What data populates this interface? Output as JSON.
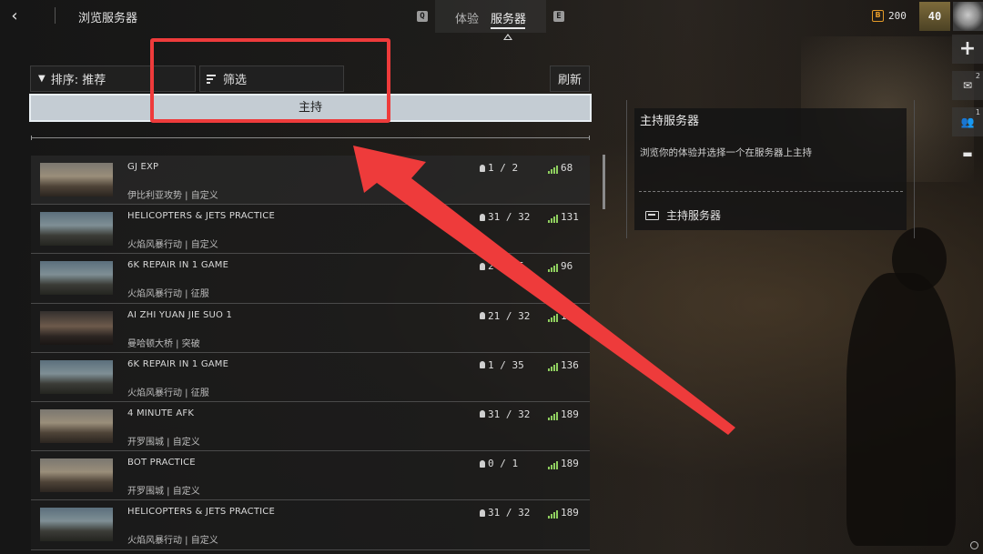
{
  "header": {
    "title": "浏览服务器",
    "back_glyph": "‹",
    "key_left": "Q",
    "key_right": "E",
    "tabs": [
      {
        "label": "体验",
        "active": false
      },
      {
        "label": "服务器",
        "active": true
      }
    ],
    "currency_symbol": "B",
    "currency_value": "200",
    "rank": "40"
  },
  "side_strip": {
    "plus_glyph": "+",
    "mail_count": "2",
    "friends_count": "1",
    "mail_glyph": "✉",
    "friends_glyph": "👥",
    "chat_glyph": "▬"
  },
  "controls": {
    "sort_label": "排序: 推荐",
    "filter_label": "筛选",
    "refresh_label": "刷新",
    "host_label": "主持"
  },
  "servers": [
    {
      "name": "GJ EXP",
      "map": "伊比利亚攻势",
      "mode": "自定义",
      "players": "1 / 2",
      "ping": "68",
      "thumb": "desert"
    },
    {
      "name": "HELICOPTERS & JETS PRACTICE",
      "map": "火焰风暴行动",
      "mode": "自定义",
      "players": "31 / 32",
      "ping": "131",
      "thumb": "jets"
    },
    {
      "name": "6K REPAIR IN 1 GAME",
      "map": "火焰风暴行动",
      "mode": "征服",
      "players": "2 / 35",
      "ping": "96",
      "thumb": "jets"
    },
    {
      "name": "AI ZHI YUAN JIE SUO 1",
      "map": "曼哈顿大桥",
      "mode": "突破",
      "players": "21 / 32",
      "ping": "131",
      "thumb": "city"
    },
    {
      "name": "6K REPAIR IN 1 GAME",
      "map": "火焰风暴行动",
      "mode": "征服",
      "players": "1 / 35",
      "ping": "136",
      "thumb": "jets"
    },
    {
      "name": "4 MINUTE AFK",
      "map": "开罗围城",
      "mode": "自定义",
      "players": "31 / 32",
      "ping": "189",
      "thumb": "desert"
    },
    {
      "name": "BOT PRACTICE",
      "map": "开罗围城",
      "mode": "自定义",
      "players": "0 / 1",
      "ping": "189",
      "thumb": "desert"
    },
    {
      "name": "HELICOPTERS & JETS PRACTICE",
      "map": "火焰风暴行动",
      "mode": "自定义",
      "players": "31 / 32",
      "ping": "189",
      "thumb": "jets"
    }
  ],
  "host_panel": {
    "title": "主持服务器",
    "description": "浏览你的体验并选择一个在服务器上主持",
    "action_label": "主持服务器"
  },
  "colors": {
    "annotation": "#ee3b3b",
    "ping_good": "#8fcf5f",
    "currency": "#e39a28",
    "host_bar": "#c4ccd3"
  }
}
